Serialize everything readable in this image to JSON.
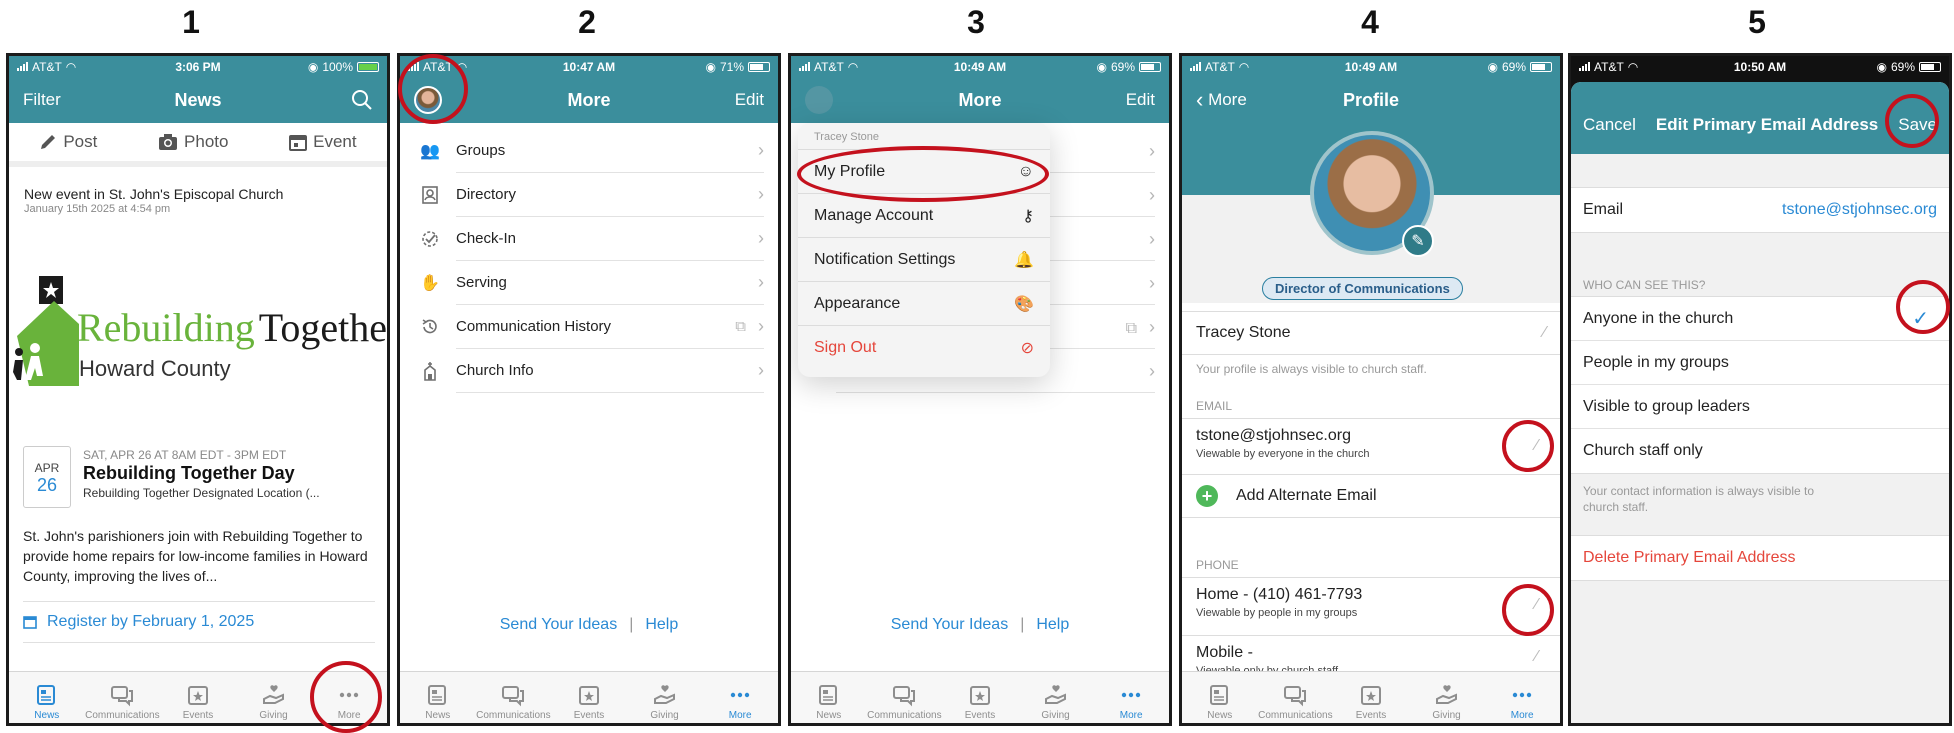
{
  "steps": [
    "1",
    "2",
    "3",
    "4",
    "5"
  ],
  "status": {
    "carrier": "AT&T",
    "p1_time": "3:06 PM",
    "p1_battery": "100%",
    "p2_time": "10:47 AM",
    "p2_battery": "71%",
    "p3_time": "10:49 AM",
    "p3_battery": "69%",
    "p4_time": "10:49 AM",
    "p4_battery": "69%",
    "p5_time": "10:50 AM",
    "p5_battery": "69%"
  },
  "tabs": [
    "News",
    "Communications",
    "Events",
    "Giving",
    "More"
  ],
  "p1": {
    "nav_left": "Filter",
    "title": "News",
    "post": "Post",
    "photo": "Photo",
    "event": "Event",
    "feed_title": "New event in St. John's Episcopal Church",
    "feed_date": "January 15th 2025 at 4:54 pm",
    "logo_word1": "Rebuilding",
    "logo_word2": "Together",
    "logo_sub": "Howard County",
    "month": "APR",
    "day": "26",
    "event_time": "SAT, APR 26 AT 8AM EDT - 3PM EDT",
    "event_name": "Rebuilding Together Day",
    "event_location": "Rebuilding Together Designated Location (...",
    "event_desc": "St. John's parishioners join with Rebuilding Together to provide home repairs for low-income families in Howard County, improving the lives of...",
    "register": "Register by February 1, 2025"
  },
  "p2": {
    "title": "More",
    "nav_right": "Edit",
    "items": [
      "Groups",
      "Directory",
      "Check-In",
      "Serving",
      "Communication History",
      "Church Info"
    ],
    "send_ideas": "Send Your Ideas",
    "help": "Help"
  },
  "p3": {
    "title": "More",
    "nav_right": "Edit",
    "menu_header": "Tracey Stone",
    "menu_items": [
      "My Profile",
      "Manage Account",
      "Notification Settings",
      "Appearance",
      "Sign Out"
    ],
    "send_ideas": "Send Your Ideas",
    "help": "Help"
  },
  "p4": {
    "back": "More",
    "title": "Profile",
    "role": "Director of Communications",
    "name": "Tracey Stone",
    "visible_note": "Your profile is always visible to church staff.",
    "email_header": "EMAIL",
    "email": "tstone@stjohnsec.org",
    "email_visibility": "Viewable by everyone in the church",
    "add_email": "Add Alternate Email",
    "phone_header": "PHONE",
    "home_phone": "Home - (410) 461-7793",
    "home_visibility": "Viewable by people in my groups",
    "mobile": "Mobile -",
    "mobile_visibility": "Viewable only by church staff"
  },
  "p5": {
    "cancel": "Cancel",
    "title": "Edit Primary Email Address",
    "save": "Save",
    "email_label": "Email",
    "email_value": "tstone@stjohnsec.org",
    "who_header": "WHO CAN SEE THIS?",
    "options": [
      "Anyone in the church",
      "People in my groups",
      "Visible to group leaders",
      "Church staff only"
    ],
    "selected": "Anyone in the church",
    "note": "Your contact information is always visible to church staff.",
    "delete": "Delete Primary Email Address"
  },
  "colors": {
    "teal": "#3b8e9c",
    "blue": "#2a8ad4",
    "red_annotation": "#c4111d",
    "delete_red": "#e5463b"
  }
}
